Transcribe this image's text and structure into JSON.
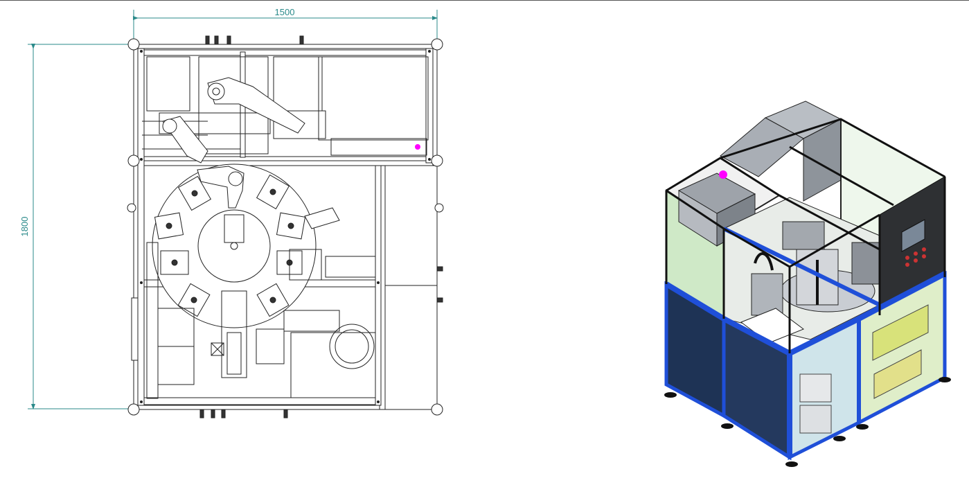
{
  "drawing": {
    "width_label": "1500",
    "height_label": "1800"
  },
  "colors": {
    "dimension": "#2a8a8a",
    "line": "#222222",
    "frame_blue": "#1f4fd8",
    "panel_navy": "#1e3355",
    "cover_grey": "#9aa0a8",
    "glass": "#d8efd2",
    "marker": "#ff00ff"
  }
}
